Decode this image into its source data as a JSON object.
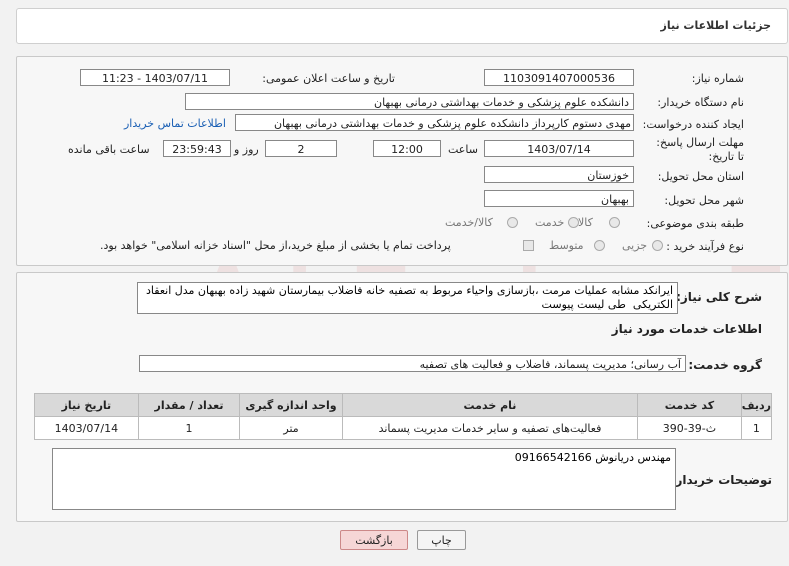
{
  "page_title": "جزئیات اطلاعات نیاز",
  "watermark": "AriaTender.neT",
  "need_info": {
    "need_number_label": "شماره نیاز:",
    "need_number": "1103091407000536",
    "announce_label": "تاریخ و ساعت اعلان عمومی:",
    "announce_value": "1403/07/11 - 11:23",
    "buyer_org_label": "نام دستگاه خریدار:",
    "buyer_org": "دانشکده علوم پزشکی و خدمات بهداشتی  درمانی بهبهان",
    "requester_label": "ایجاد کننده درخواست:",
    "requester": "مهدی دستوم کارپرداز دانشکده علوم پزشکی و خدمات بهداشتی  درمانی بهبهان",
    "contact_link": "اطلاعات تماس خریدار",
    "deadline_label": "مهلت ارسال پاسخ: تا تاریخ:",
    "deadline_date": "1403/07/14",
    "time_label": "ساعت",
    "deadline_time": "12:00",
    "days_value": "2",
    "days_label": "روز و",
    "remaining_time": "23:59:43",
    "remaining_label": "ساعت باقی مانده",
    "province_label": "استان محل تحویل:",
    "province": "خوزستان",
    "city_label": "شهر محل تحویل:",
    "city": "بهبهان",
    "category_label": "طبقه بندی موضوعی:",
    "category_options": [
      "کالا",
      "خدمت",
      "کالا/خدمت"
    ],
    "process_label": "نوع فرآیند خرید :",
    "process_options": [
      "جزیی",
      "متوسط"
    ],
    "payment_note": "پرداخت تمام یا بخشی از مبلغ خرید،از محل \"اسناد خزانه اسلامی\" خواهد بود."
  },
  "description": {
    "label": "شرح کلی نیاز:",
    "text": "ایرانکد مشابه عملیات مرمت ،بازسازی واحیاء مربوط به تصفیه خانه فاضلاب بیمارستان شهید زاده بهبهان مدل انعقاد الکتریکی  طی لیست پیوست"
  },
  "services_heading": "اطلاعات خدمات مورد نیاز",
  "service_group_label": "گروه خدمت:",
  "service_group": "آب رسانی؛ مدیریت پسماند، فاضلاب و فعالیت های تصفیه",
  "table": {
    "headers": [
      "ردیف",
      "کد خدمت",
      "نام خدمت",
      "واحد اندازه گیری",
      "تعداد / مقدار",
      "تاریخ نیاز"
    ],
    "rows": [
      [
        "1",
        "ث-39-390",
        "فعالیت‌های تصفیه و سایر خدمات مدیریت پسماند",
        "متر",
        "1",
        "1403/07/14"
      ]
    ]
  },
  "buyer_notes_label": "توضیحات خریدار:",
  "buyer_notes": "مهندس دریانوش 09166542166",
  "buttons": {
    "print": "چاپ",
    "back": "بازگشت"
  }
}
